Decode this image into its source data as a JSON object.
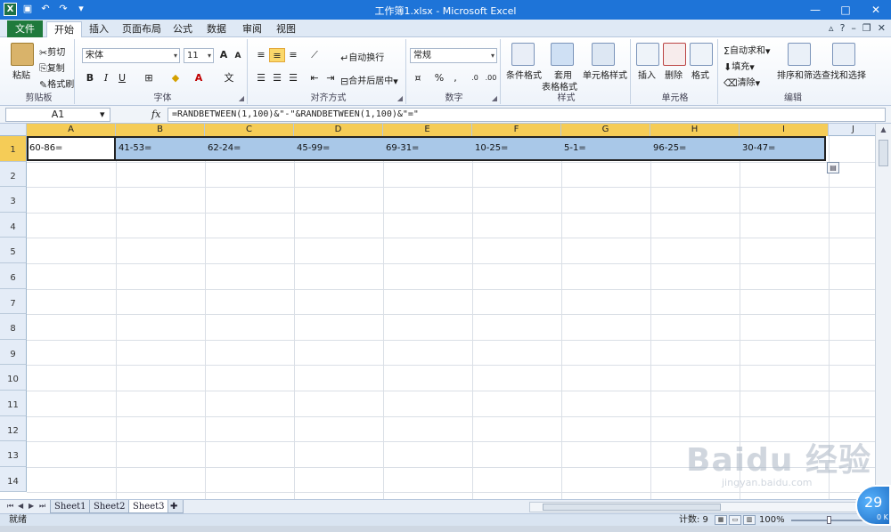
{
  "window": {
    "title": "工作簿1.xlsx - Microsoft Excel",
    "app_icon": "X",
    "controls": [
      "—",
      "□",
      "✕"
    ]
  },
  "ribbon": {
    "tabs": [
      "文件",
      "开始",
      "插入",
      "页面布局",
      "公式",
      "数据",
      "审阅",
      "视图"
    ],
    "active_tab": "开始",
    "clipboard": {
      "paste": "粘贴",
      "cut": "剪切",
      "copy": "复制",
      "format_painter": "格式刷",
      "label": "剪贴板"
    },
    "font": {
      "name": "宋体",
      "size": "11",
      "label": "字体"
    },
    "alignment": {
      "wrap": "自动换行",
      "merge": "合并后居中",
      "label": "对齐方式"
    },
    "number": {
      "format": "常规",
      "label": "数字"
    },
    "styles": {
      "conditional": "条件格式",
      "table_line1": "套用",
      "table_line2": "表格格式",
      "cell_styles": "单元格样式",
      "label": "样式"
    },
    "cells": {
      "insert": "插入",
      "delete": "删除",
      "format": "格式",
      "label": "单元格"
    },
    "editing": {
      "autosum": "自动求和",
      "fill": "填充",
      "clear": "清除",
      "sort": "排序和筛选",
      "find": "查找和选择",
      "label": "编辑"
    }
  },
  "formula_bar": {
    "name_box": "A1",
    "fx": "fx",
    "formula": "=RANDBETWEEN(1,100)&\"-\"&RANDBETWEEN(1,100)&\"=\""
  },
  "grid": {
    "columns": [
      "A",
      "B",
      "C",
      "D",
      "E",
      "F",
      "G",
      "H",
      "I",
      "J"
    ],
    "rows": [
      "1",
      "2",
      "3",
      "4",
      "5",
      "6",
      "7",
      "8",
      "9",
      "10",
      "11",
      "12",
      "13",
      "14"
    ],
    "row1_values": [
      "60-86=",
      "41-53=",
      "62-24=",
      "45-99=",
      "69-31=",
      "10-25=",
      "5-1=",
      "96-25=",
      "30-47="
    ]
  },
  "sheets": [
    "Sheet1",
    "Sheet2",
    "Sheet3"
  ],
  "active_sheet": "Sheet3",
  "status": {
    "ready": "就绪",
    "count": "计数: 9",
    "zoom": "100%"
  },
  "overlay": {
    "percent": "29",
    "sub": "0 K"
  },
  "watermark": {
    "brand": "Baidu 经验",
    "url": "jingyan.baidu.com"
  },
  "colors": {
    "titlebar": "#1e74d8",
    "file_tab": "#1f7a3c",
    "selection": "#a9c8e8",
    "header_selected": "#f5cc57"
  }
}
